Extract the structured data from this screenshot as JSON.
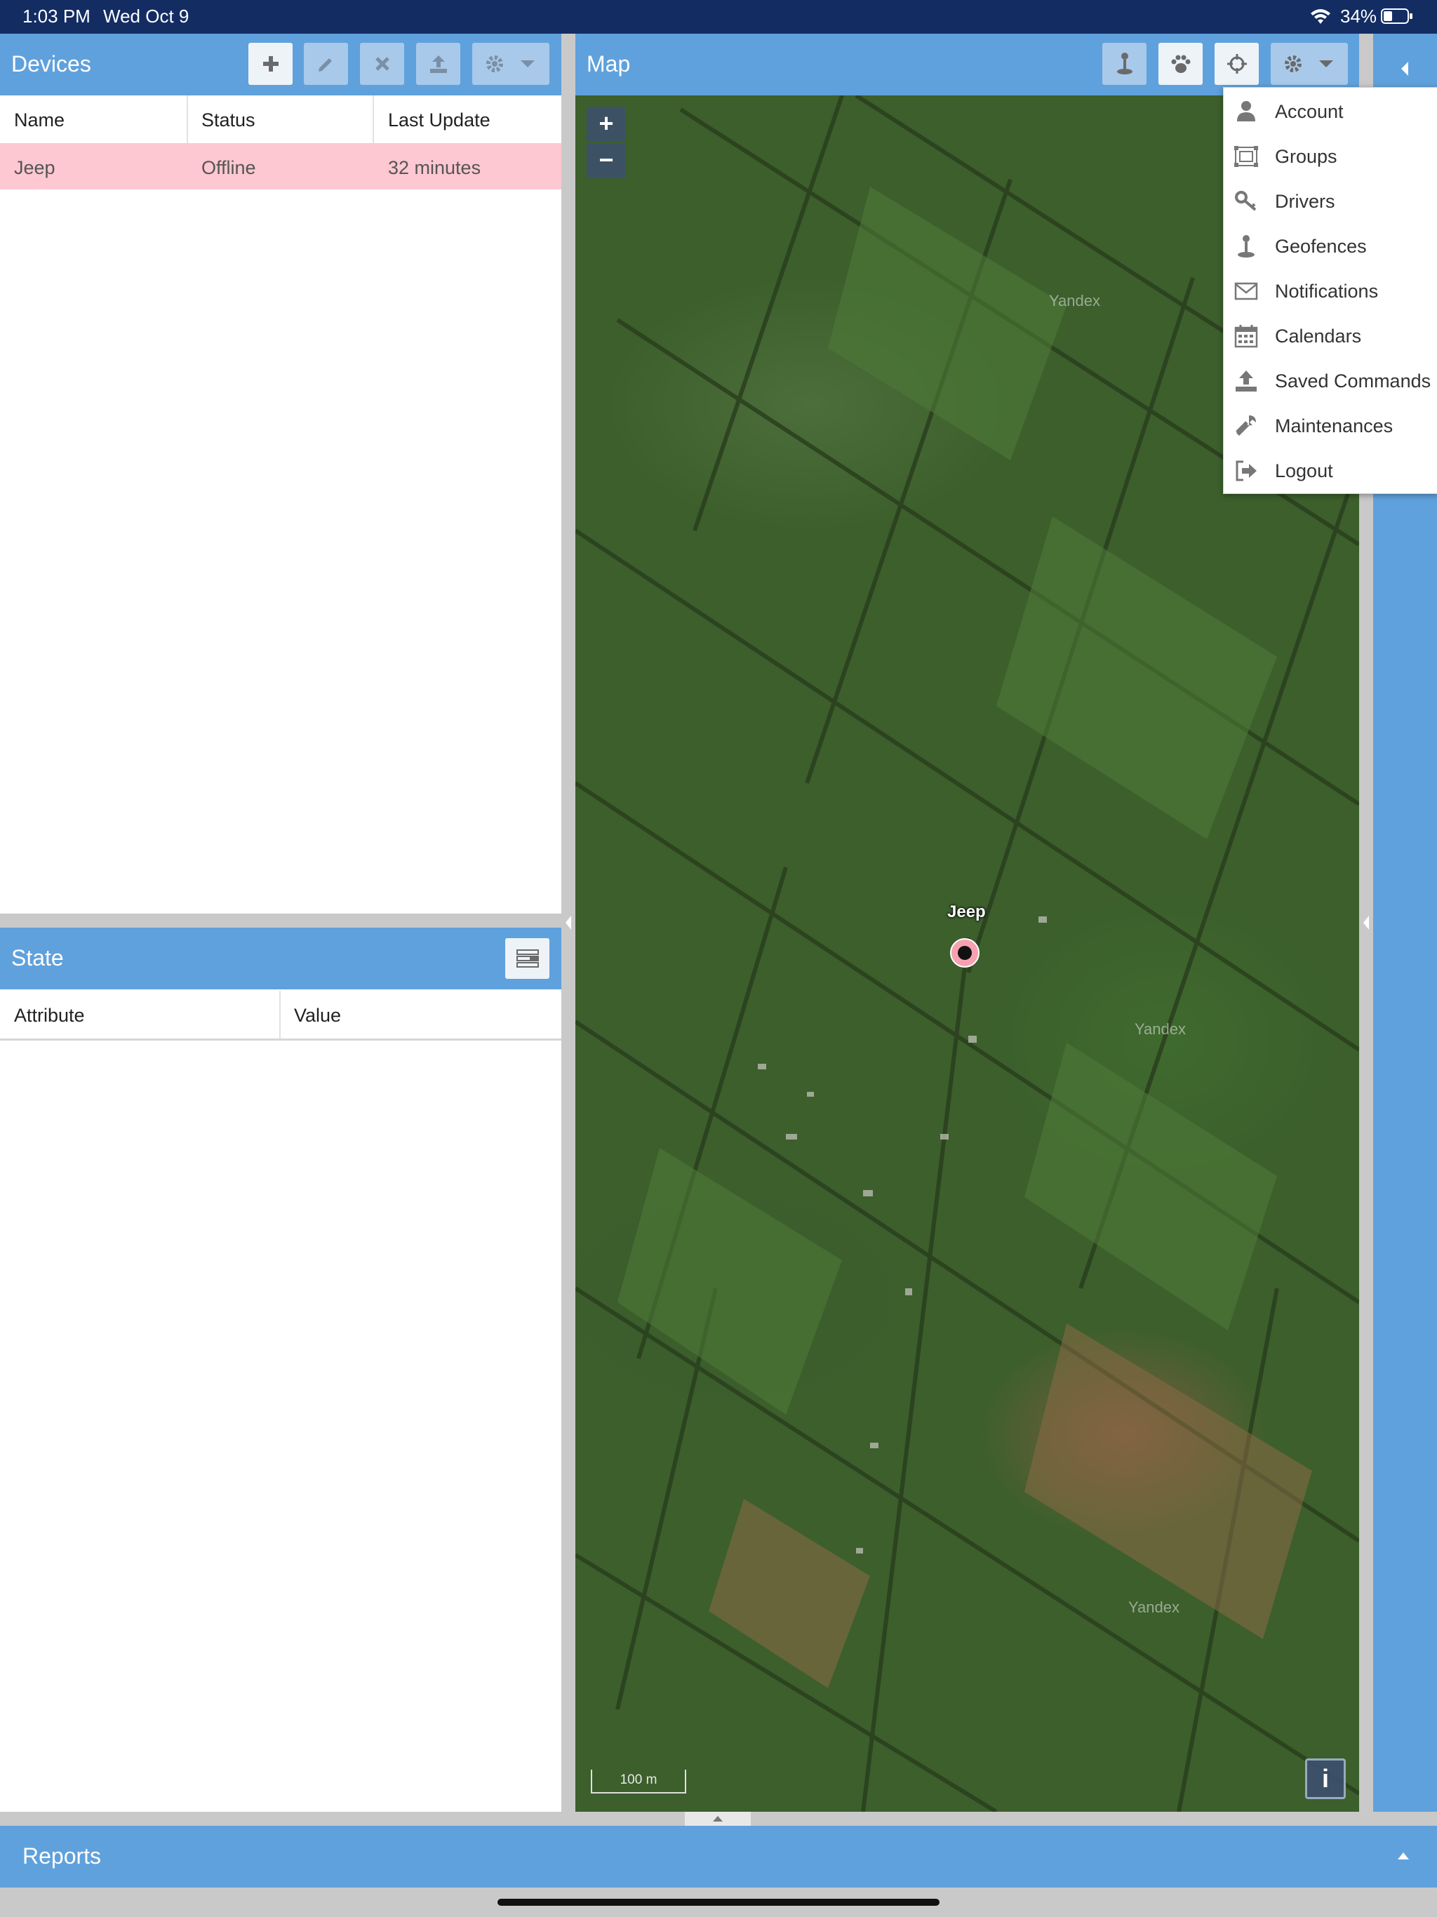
{
  "status_bar": {
    "time": "1:03 PM",
    "date": "Wed Oct 9",
    "battery": "34%"
  },
  "devices": {
    "title": "Devices",
    "columns": [
      "Name",
      "Status",
      "Last Update"
    ],
    "rows": [
      {
        "name": "Jeep",
        "status": "Offline",
        "last_update": "32 minutes"
      }
    ],
    "row_highlight_color": "#fdc8d1"
  },
  "state": {
    "title": "State",
    "columns": [
      "Attribute",
      "Value"
    ]
  },
  "map": {
    "title": "Map",
    "marker_label": "Jeep",
    "watermark": "Yandex",
    "scale": "100 m",
    "zoom_in": "+",
    "zoom_out": "−",
    "info": "i"
  },
  "settings_menu": {
    "items": [
      {
        "label": "Account",
        "icon": "user-icon"
      },
      {
        "label": "Groups",
        "icon": "groups-icon"
      },
      {
        "label": "Drivers",
        "icon": "key-icon"
      },
      {
        "label": "Geofences",
        "icon": "pin-icon"
      },
      {
        "label": "Notifications",
        "icon": "envelope-icon"
      },
      {
        "label": "Calendars",
        "icon": "calendar-icon"
      },
      {
        "label": "Saved Commands",
        "icon": "upload-icon"
      },
      {
        "label": "Maintenances",
        "icon": "wrench-icon"
      },
      {
        "label": "Logout",
        "icon": "logout-icon"
      }
    ]
  },
  "reports": {
    "title": "Reports"
  },
  "colors": {
    "header_blue": "#5fa1dc",
    "status_bar": "#132d63",
    "marker": "#f7a1b0"
  }
}
